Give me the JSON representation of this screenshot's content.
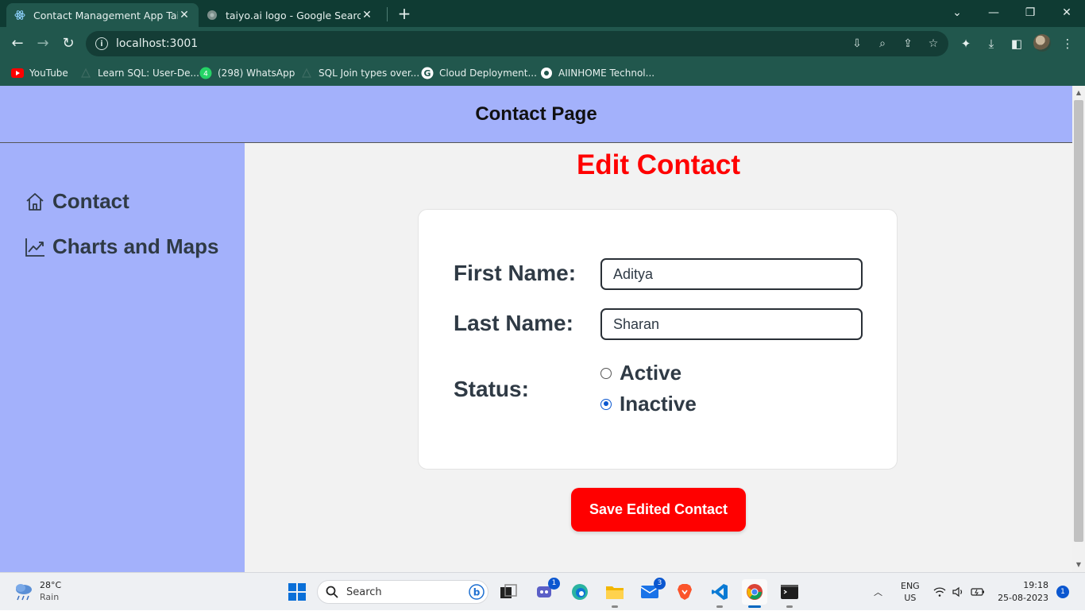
{
  "browser": {
    "tabs": [
      {
        "title": "Contact Management App Taiyo",
        "active": true
      },
      {
        "title": "taiyo.ai logo - Google Search",
        "active": false
      }
    ],
    "url": "localhost:3001",
    "bookmarks": [
      "YouTube",
      "Learn SQL: User-De...",
      "(298) WhatsApp",
      "SQL Join types over...",
      "Cloud Deployment...",
      "AIINHOME Technol..."
    ]
  },
  "app": {
    "header_title": "Contact Page",
    "sidebar": [
      {
        "label": "Contact",
        "icon": "home-icon"
      },
      {
        "label": "Charts and Maps",
        "icon": "chart-line-icon"
      }
    ],
    "page_title": "Edit Contact",
    "form": {
      "first_name_label": "First Name:",
      "first_name_value": "Aditya",
      "last_name_label": "Last Name:",
      "last_name_value": "Sharan",
      "status_label": "Status:",
      "status_options": [
        "Active",
        "Inactive"
      ],
      "status_selected": "Inactive"
    },
    "save_button": "Save Edited Contact",
    "colors": {
      "accent_red": "#ff0000",
      "sidebar_bg": "#a3b1fb",
      "main_bg": "#f2f2f2"
    }
  },
  "taskbar": {
    "weather_temp": "28°C",
    "weather_desc": "Rain",
    "search_placeholder": "Search",
    "badges": {
      "teams": "1",
      "mail": "3"
    },
    "lang_top": "ENG",
    "lang_bottom": "US",
    "time": "19:18",
    "date": "25-08-2023",
    "notifications": "1"
  }
}
